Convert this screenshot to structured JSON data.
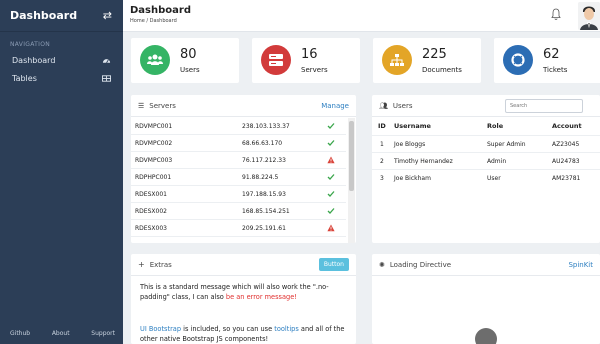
{
  "sidebar": {
    "title": "Dashboard",
    "nav_label": "NAVIGATION",
    "items": [
      {
        "label": "Dashboard",
        "icon": "speedometer-icon"
      },
      {
        "label": "Tables",
        "icon": "table-icon"
      }
    ],
    "footer": [
      "Github",
      "About",
      "Support"
    ]
  },
  "header": {
    "title": "Dashboard",
    "breadcrumb": "Home / Dashboard"
  },
  "stats": [
    {
      "value": "80",
      "label": "Users",
      "color": "#35b465"
    },
    {
      "value": "16",
      "label": "Servers",
      "color": "#d23b3b"
    },
    {
      "value": "225",
      "label": "Documents",
      "color": "#e3a527"
    },
    {
      "value": "62",
      "label": "Tickets",
      "color": "#2c6db4"
    }
  ],
  "servers": {
    "title": "Servers",
    "action": "Manage",
    "rows": [
      {
        "name": "RDVMPC001",
        "ip": "238.103.133.37",
        "status": "ok"
      },
      {
        "name": "RDVMPC002",
        "ip": "68.66.63.170",
        "status": "ok"
      },
      {
        "name": "RDVMPC003",
        "ip": "76.117.212.33",
        "status": "warn"
      },
      {
        "name": "RDPHPC001",
        "ip": "91.88.224.5",
        "status": "ok"
      },
      {
        "name": "RDESX001",
        "ip": "197.188.15.93",
        "status": "ok"
      },
      {
        "name": "RDESX002",
        "ip": "168.85.154.251",
        "status": "ok"
      },
      {
        "name": "RDESX003",
        "ip": "209.25.191.61",
        "status": "warn"
      }
    ]
  },
  "users": {
    "title": "Users",
    "search_placeholder": "Search",
    "columns": [
      "ID",
      "Username",
      "Role",
      "Account"
    ],
    "rows": [
      {
        "id": "1",
        "username": "Joe Bloggs",
        "role": "Super Admin",
        "account": "AZ23045"
      },
      {
        "id": "2",
        "username": "Timothy Hernandez",
        "role": "Admin",
        "account": "AU24783"
      },
      {
        "id": "3",
        "username": "Joe Bickham",
        "role": "User",
        "account": "AM23781"
      }
    ]
  },
  "extras": {
    "title": "Extras",
    "button": "Button",
    "p1_a": "This is a standard message which will also work the \".no-padding\" class, I can also",
    "p1_error": "be an error message!",
    "p2_link1": "UI Bootstrap",
    "p2_mid": "is included, so you can use",
    "p2_link2": "tooltips",
    "p2_end": "and all of the other native Bootstrap JS components!"
  },
  "loading": {
    "title": "Loading Directive",
    "action": "SpinKit"
  },
  "colors": {
    "ok": "#3aa64b",
    "warn": "#d9443a",
    "sidebar": "#2c3e57",
    "link": "#2d7fc1"
  }
}
